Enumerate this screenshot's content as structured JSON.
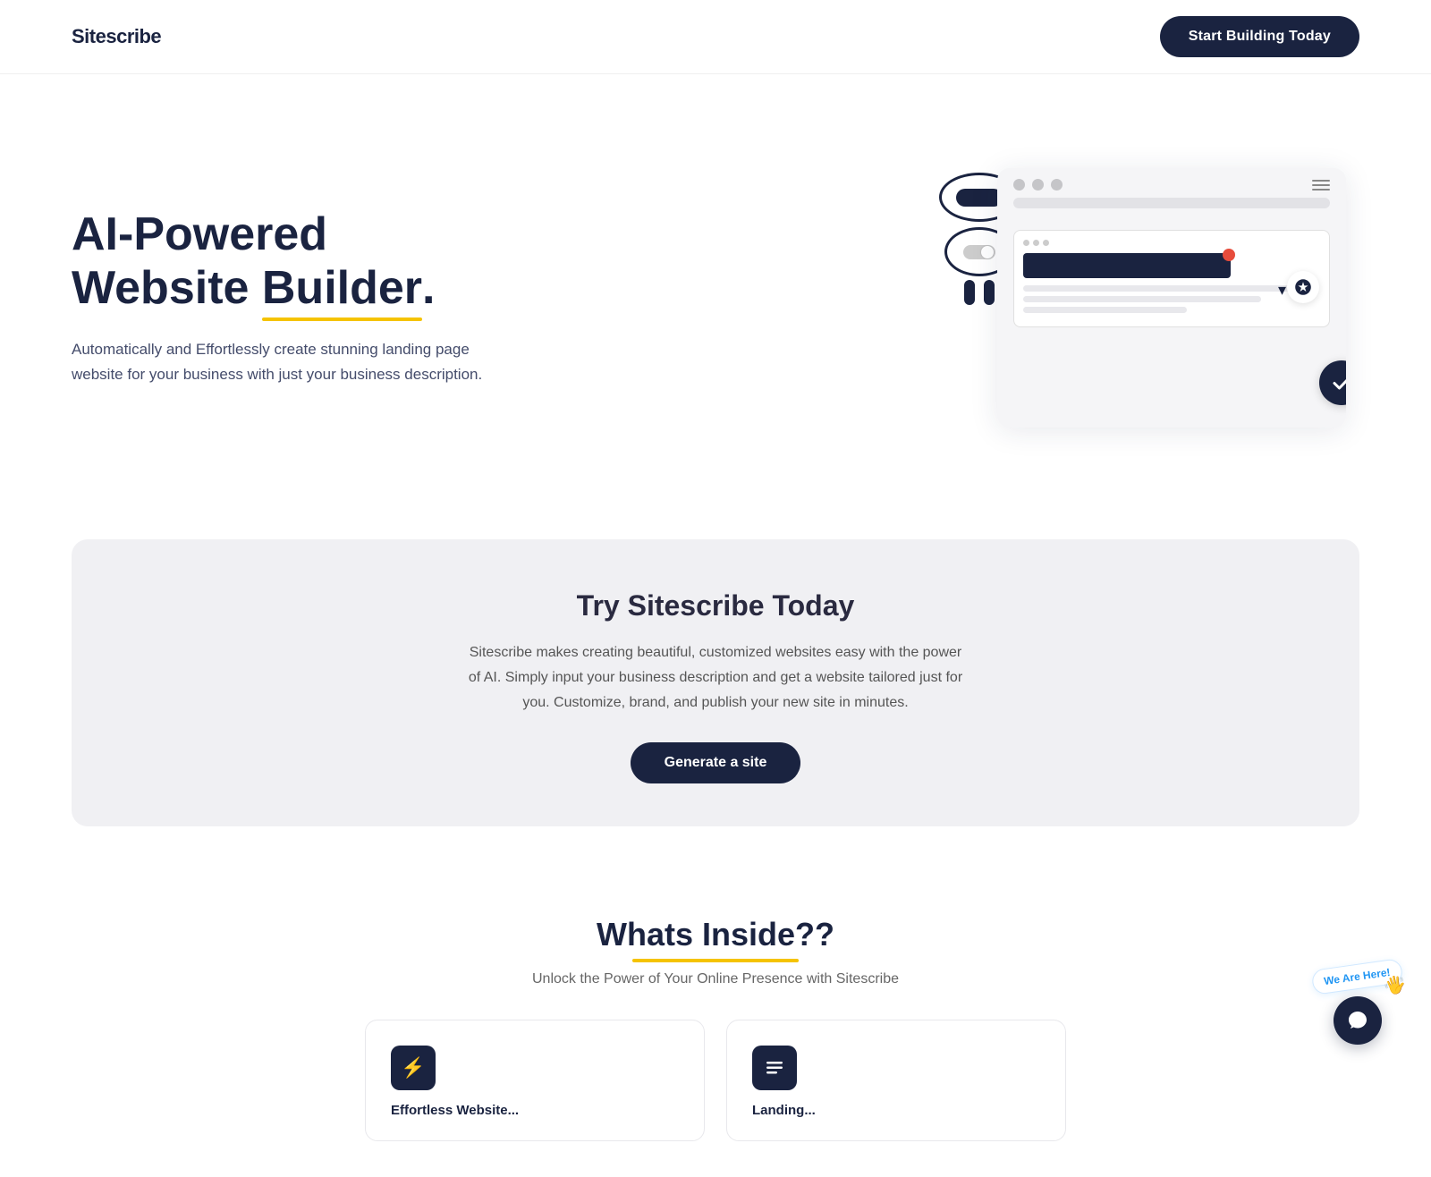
{
  "navbar": {
    "logo": "Sitescribe",
    "cta_label": "Start Building Today"
  },
  "hero": {
    "title_line1": "AI-Powered",
    "title_line2_plain": "Website ",
    "title_line2_underline": "Builder",
    "title_period": ".",
    "description": "Automatically and Effortlessly create stunning landing page website for your business with just your business description."
  },
  "try_section": {
    "title": "Try Sitescribe Today",
    "description": "Sitescribe makes creating beautiful, customized websites easy with the power of AI. Simply input your business description and get a website tailored just for you. Customize, brand, and publish your new site in minutes.",
    "cta_label": "Generate a site"
  },
  "inside_section": {
    "title": "Whats Inside??",
    "subtitle": "Unlock the Power of Your Online Presence with Sitescribe",
    "cards": [
      {
        "icon": "⚡",
        "label": "Effortless Website..."
      },
      {
        "icon": "≡",
        "label": "Landing..."
      }
    ]
  },
  "chat_widget": {
    "bubble_text": "We Are Here!",
    "hand_emoji": "👋"
  }
}
